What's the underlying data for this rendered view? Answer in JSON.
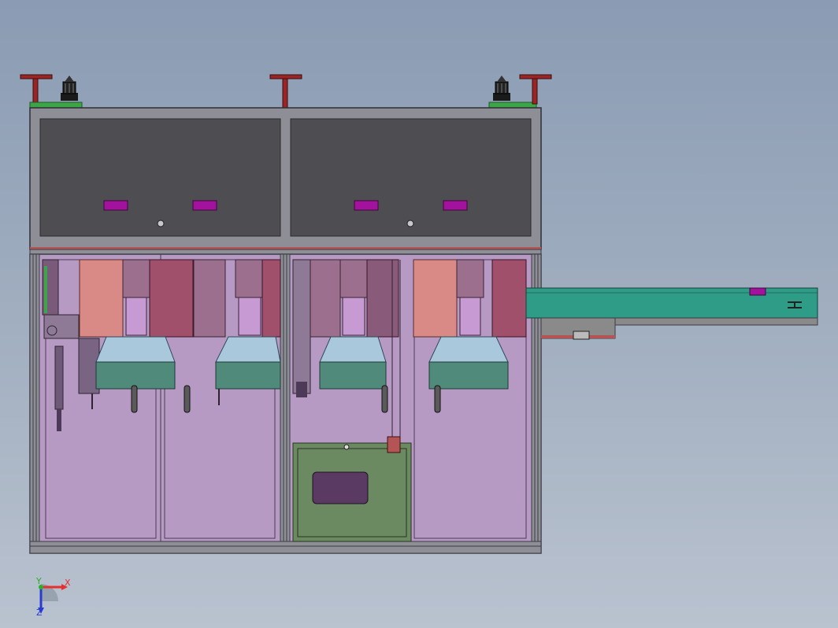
{
  "viewport": {
    "background_top": "#8a9bb3",
    "background_bottom": "#b9c2cf"
  },
  "colors": {
    "frame": "#8e8e96",
    "frame_dark": "#3c3c44",
    "panel": "#4e4e52",
    "panel_border": "#2a2a2e",
    "button": "#a3129c",
    "enclosure": "#b69ac4",
    "cylinder_salmon": "#d98a86",
    "cylinder_mauve": "#9c6f8e",
    "hopper_top": "#a9c8dc",
    "hopper_front": "#4f8a7a",
    "box_green": "#6b8a62",
    "conveyor": "#2e9c86",
    "conveyor_base": "#8a8a8a",
    "beacon": "#1a1a1a",
    "post": "#9b2424"
  },
  "axis_triad": {
    "x_label": "X",
    "y_label": "Y",
    "z_label": "Z",
    "x_color": "#e53030",
    "y_color": "#28b028",
    "z_color": "#2a3cd0"
  }
}
